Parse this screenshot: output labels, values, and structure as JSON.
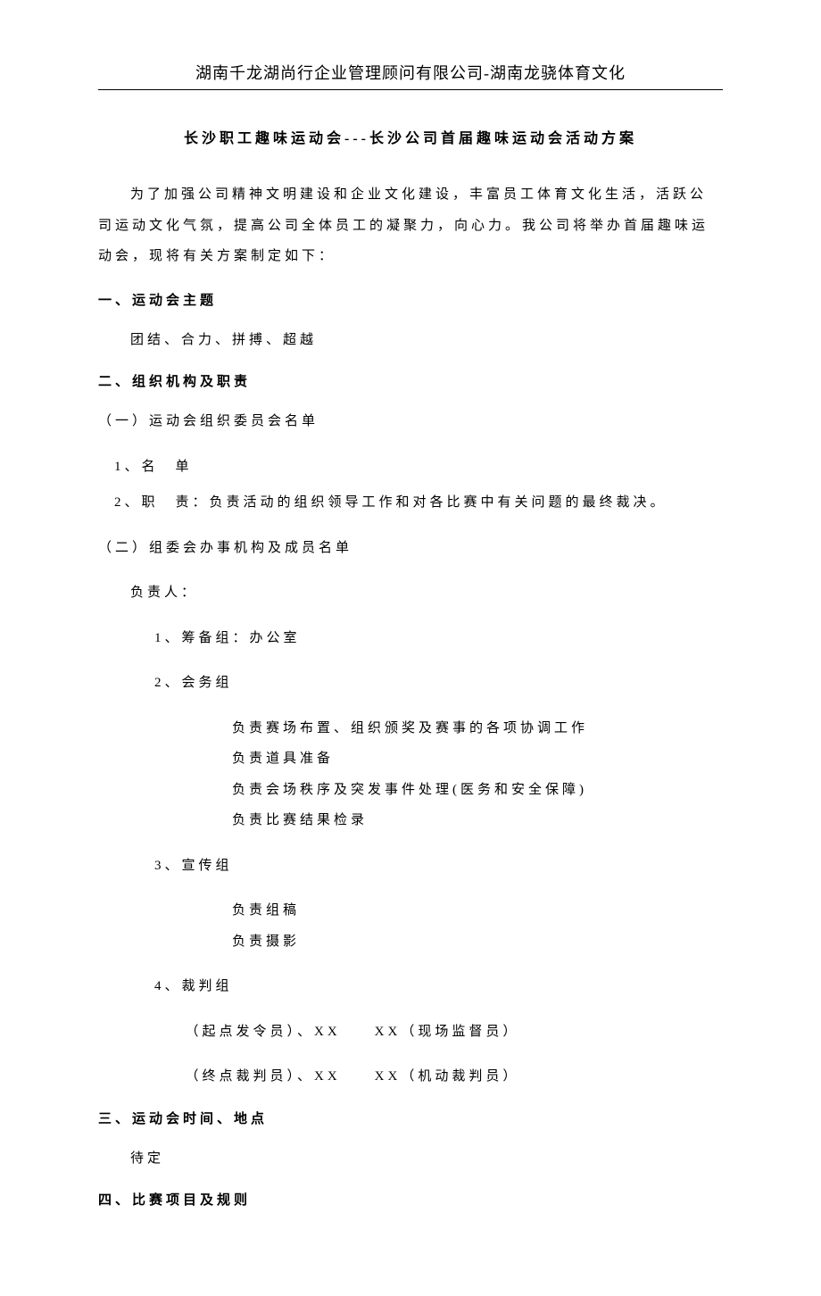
{
  "header": "湖南千龙湖尚行企业管理顾问有限公司-湖南龙骁体育文化",
  "title": "长沙职工趣味运动会---长沙公司首届趣味运动会活动方案",
  "intro": "为了加强公司精神文明建设和企业文化建设，丰富员工体育文化生活，活跃公司运动文化气氛，提高公司全体员工的凝聚力，向心力。我公司将举办首届趣味运动会，现将有关方案制定如下：",
  "s1": {
    "head": "一、运动会主题",
    "body": "团结、合力、拼搏、超越"
  },
  "s2": {
    "head": "二、组织机构及职责",
    "p1": {
      "title": "（一）运动会组织委员会名单",
      "l1": "1、名　单",
      "l2": "2、职　责：负责活动的组织领导工作和对各比赛中有关问题的最终裁决。"
    },
    "p2": {
      "title": "（二）组委会办事机构及成员名单",
      "lead": "负责人：",
      "g1": "1、筹备组：办公室",
      "g2": "2、会务组",
      "g2a": "负责赛场布置、组织颁奖及赛事的各项协调工作",
      "g2b": "负责道具准备",
      "g2c": "负责会场秩序及突发事件处理(医务和安全保障)",
      "g2d": "负责比赛结果检录",
      "g3": "3、宣传组",
      "g3a": "负责组稿",
      "g3b": "负责摄影",
      "g4": "4、裁判组",
      "g4a": "（起点发令员）、XX　　XX（现场监督员）",
      "g4b": "（终点裁判员）、XX　　XX（机动裁判员）"
    }
  },
  "s3": {
    "head": "三、运动会时间、地点",
    "body": "待定"
  },
  "s4": {
    "head": "四、比赛项目及规则"
  }
}
